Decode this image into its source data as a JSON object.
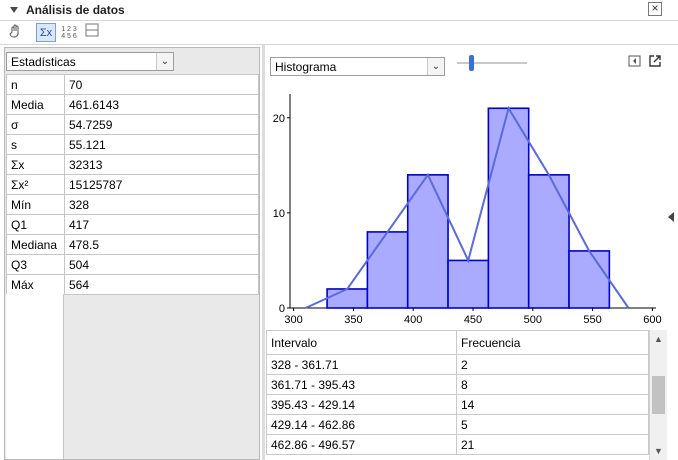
{
  "window": {
    "title": "Análisis de datos",
    "close_icon": "close-icon"
  },
  "toolbar": {
    "buttons": [
      "hand-icon",
      "sigma-stats-icon",
      "numbers-grid-icon",
      "layout-icon"
    ],
    "sigma_label": "Σx",
    "grid_label": "1 2 3\n4 5 6"
  },
  "left": {
    "dropdown": "Estadísticas",
    "stats": [
      {
        "k": "n",
        "v": "70"
      },
      {
        "k": "Media",
        "v": "461.6143"
      },
      {
        "k": "σ",
        "v": "54.7259"
      },
      {
        "k": "s",
        "v": "55.121"
      },
      {
        "k": "Σx",
        "v": "32313"
      },
      {
        "k": "Σx²",
        "v": "15125787"
      },
      {
        "k": "Mín",
        "v": "328"
      },
      {
        "k": "Q1",
        "v": "417"
      },
      {
        "k": "Mediana",
        "v": "478.5"
      },
      {
        "k": "Q3",
        "v": "504"
      },
      {
        "k": "Máx",
        "v": "564"
      }
    ]
  },
  "right": {
    "dropdown": "Histograma",
    "slider_value": 0.2
  },
  "chart_data": {
    "type": "bar",
    "xlim": [
      297,
      603
    ],
    "ylim": [
      0,
      22.5
    ],
    "xticks": [
      300,
      350,
      400,
      450,
      500,
      550,
      600
    ],
    "yticks": [
      0,
      10,
      20
    ],
    "bins": [
      {
        "lo": 328,
        "hi": 361.71,
        "f": 2
      },
      {
        "lo": 361.71,
        "hi": 395.43,
        "f": 8
      },
      {
        "lo": 395.43,
        "hi": 429.14,
        "f": 14
      },
      {
        "lo": 429.14,
        "hi": 462.86,
        "f": 5
      },
      {
        "lo": 462.86,
        "hi": 496.57,
        "f": 21
      },
      {
        "lo": 496.57,
        "hi": 530.29,
        "f": 14
      },
      {
        "lo": 530.29,
        "hi": 564,
        "f": 6
      }
    ],
    "polygon_ends": [
      310,
      580
    ],
    "bar_fill": "#aaaaff",
    "bar_stroke": "#0000cc",
    "line_color": "#5b6ad8"
  },
  "table": {
    "headers": [
      "Intervalo",
      "Frecuencia"
    ],
    "rows": [
      [
        "328 - 361.71",
        "2"
      ],
      [
        "361.71 - 395.43",
        "8"
      ],
      [
        "395.43 - 429.14",
        "14"
      ],
      [
        "429.14 - 462.86",
        "5"
      ],
      [
        "462.86 - 496.57",
        "21"
      ]
    ]
  }
}
